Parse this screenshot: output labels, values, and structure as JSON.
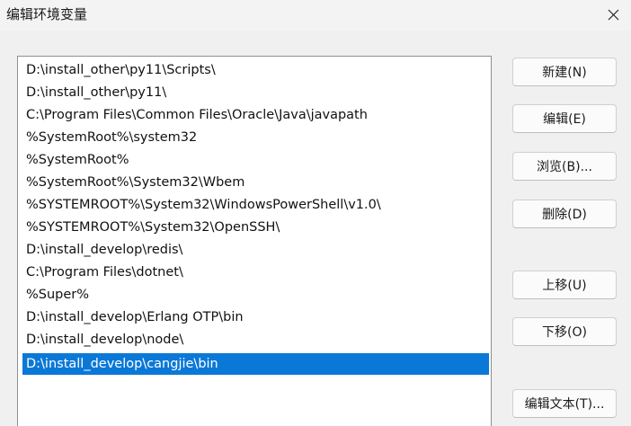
{
  "window": {
    "title": "编辑环境变量"
  },
  "path_list": [
    "D:\\install_other\\py11\\Scripts\\",
    "D:\\install_other\\py11\\",
    "C:\\Program Files\\Common Files\\Oracle\\Java\\javapath",
    "%SystemRoot%\\system32",
    "%SystemRoot%",
    "%SystemRoot%\\System32\\Wbem",
    "%SYSTEMROOT%\\System32\\WindowsPowerShell\\v1.0\\",
    "%SYSTEMROOT%\\System32\\OpenSSH\\",
    "D:\\install_develop\\redis\\",
    "C:\\Program Files\\dotnet\\",
    "%Super%",
    "D:\\install_develop\\Erlang OTP\\bin",
    "D:\\install_develop\\node\\",
    "D:\\install_develop\\cangjie\\bin"
  ],
  "buttons": {
    "new": "新建(N)",
    "edit": "编辑(E)",
    "browse": "浏览(B)...",
    "delete": "删除(D)",
    "move_up": "上移(U)",
    "move_down": "下移(O)",
    "edit_text": "编辑文本(T)..."
  },
  "colors": {
    "selection": "#0a78d7"
  }
}
